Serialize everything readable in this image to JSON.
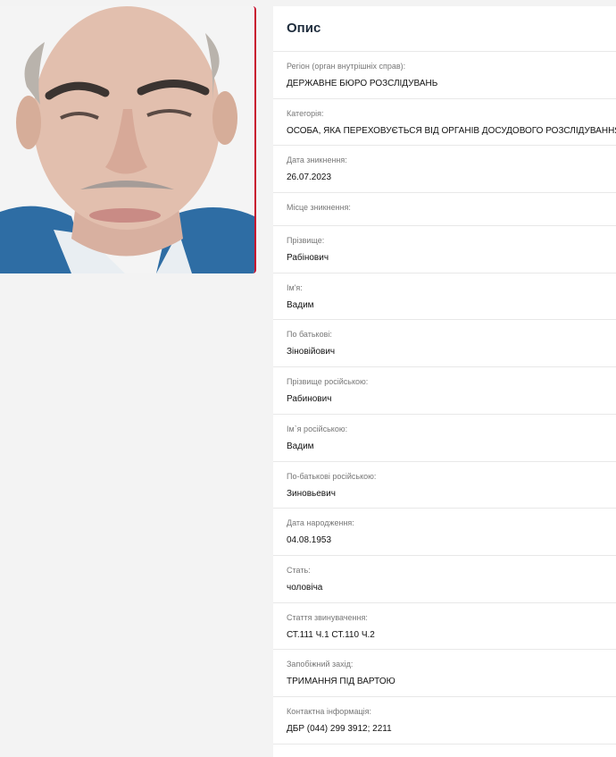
{
  "card": {
    "title": "Опис"
  },
  "fields": [
    {
      "label": "Регіон (орган внутрішніх справ):",
      "value": "ДЕРЖАВНЕ БЮРО РОЗСЛІДУВАНЬ"
    },
    {
      "label": "Категорія:",
      "value": "ОСОБА, ЯКА ПЕРЕХОВУЄТЬСЯ ВІД ОРГАНІВ ДОСУДОВОГО РОЗСЛІДУВАННЯ"
    },
    {
      "label": "Дата зникнення:",
      "value": "26.07.2023"
    },
    {
      "label": "Місце зникнення:",
      "value": ""
    },
    {
      "label": "Прізвище:",
      "value": "Рабінович"
    },
    {
      "label": "Ім'я:",
      "value": "Вадим"
    },
    {
      "label": "По батькові:",
      "value": "Зіновійович"
    },
    {
      "label": "Прізвище російською:",
      "value": "Рабинович"
    },
    {
      "label": "Ім`я російською:",
      "value": "Вадим"
    },
    {
      "label": "По-батькові російською:",
      "value": "Зиновьевич"
    },
    {
      "label": "Дата народження:",
      "value": "04.08.1953"
    },
    {
      "label": "Стать:",
      "value": "чоловіча"
    },
    {
      "label": "Стаття звинувачення:",
      "value": "СТ.111 Ч.1 СТ.110 Ч.2"
    },
    {
      "label": "Запобіжний захід:",
      "value": "ТРИМАННЯ ПІД ВАРТОЮ"
    },
    {
      "label": "Контактна інформація:",
      "value": "ДБР (044) 299 3912; 2211"
    }
  ],
  "colors": {
    "accent": "#c8102e",
    "background": "#f3f3f3"
  }
}
